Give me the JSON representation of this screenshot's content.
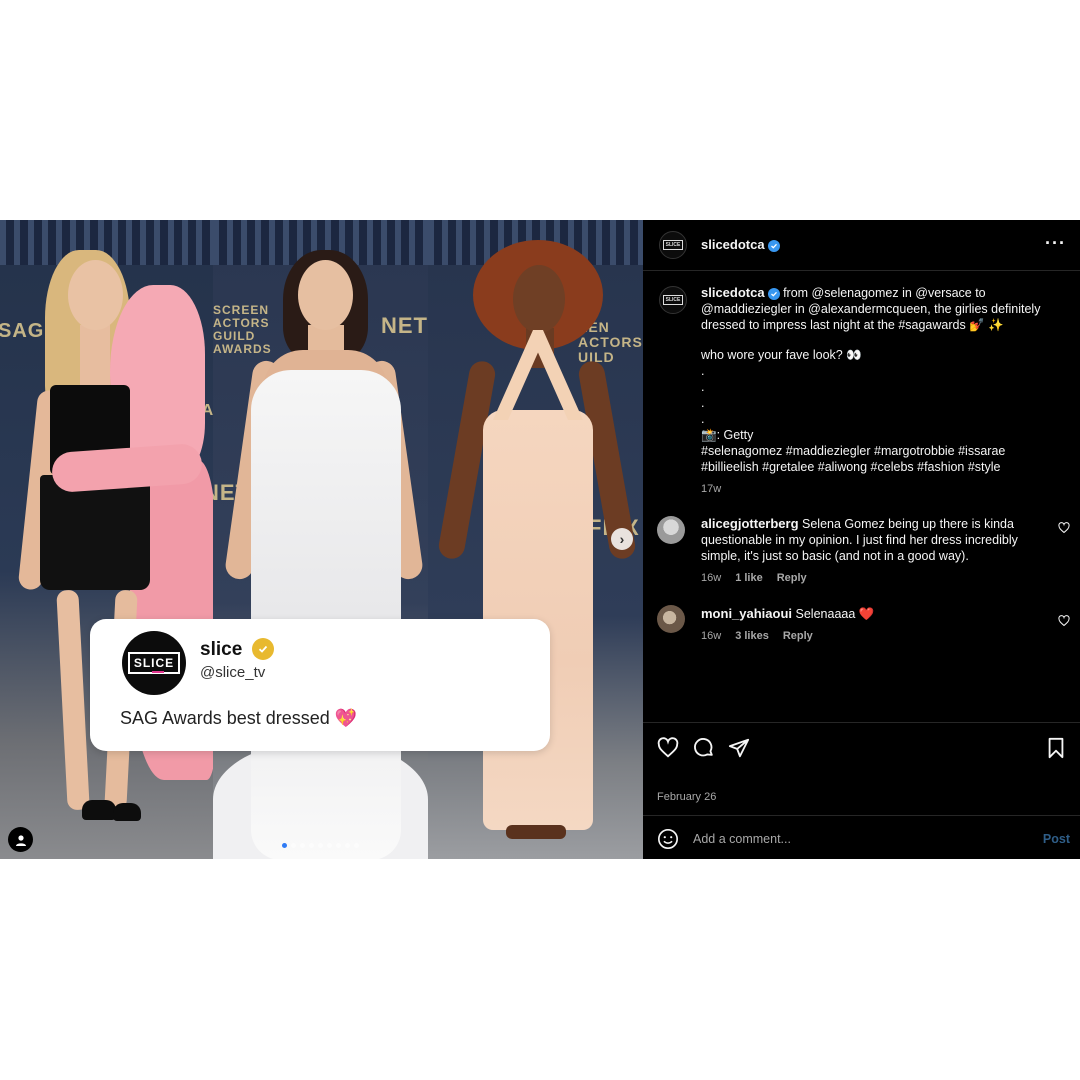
{
  "media": {
    "backdrop_text_1": "SAG·A",
    "backdrop_text_2": "SCREEN ACTORS GUILD AWARDS",
    "backdrop_text_3": "NETFLIX",
    "backdrop_text_4": "NET",
    "backdrop_text_5": "SA·AF",
    "backdrop_text_6": "EEN ACTORS UILD",
    "backdrop_text_7": "FLIX",
    "carousel_dots": 9,
    "active_dot": 0,
    "tweet": {
      "name": "slice",
      "handle": "@slice_tv",
      "logo_text": "SLICE",
      "text": "SAG Awards best dressed 💖"
    }
  },
  "post": {
    "username": "slicedotca",
    "avatar_text": "SLICE",
    "caption_line_1": "from @selenagomez in @versace to @maddieziegler in @alexandermcqueen, the girlies definitely dressed to impress last night at the #sagawards 💅 ✨",
    "caption_line_2": "who wore your fave look? 👀",
    "caption_dots": [
      ".",
      ".",
      ".",
      "."
    ],
    "caption_credit": "📸: Getty",
    "caption_tags": "#selenagomez #maddieziegler #margotrobbie #issarae #billieelish #gretalee #aliwong #celebs #fashion #style",
    "caption_age": "17w"
  },
  "comments": [
    {
      "username": "alicegjotterberg",
      "text": "Selena Gomez being up there is kinda questionable in my opinion. I just find her dress incredibly simple, it's just so basic (and not in a good way).",
      "age": "16w",
      "likes": "1 like",
      "reply": "Reply"
    },
    {
      "username": "moni_yahiaoui",
      "text": "Selenaaaa ❤️",
      "age": "16w",
      "likes": "3 likes",
      "reply": "Reply"
    }
  ],
  "footer": {
    "date": "February 26",
    "comment_placeholder": "Add a comment...",
    "post_label": "Post"
  },
  "colors": {
    "background": "#000000",
    "verified_blue": "#3897f0",
    "verified_gold": "#e8b92f",
    "heart_red": "#e0245e",
    "muted_text": "#a8a8a8"
  }
}
